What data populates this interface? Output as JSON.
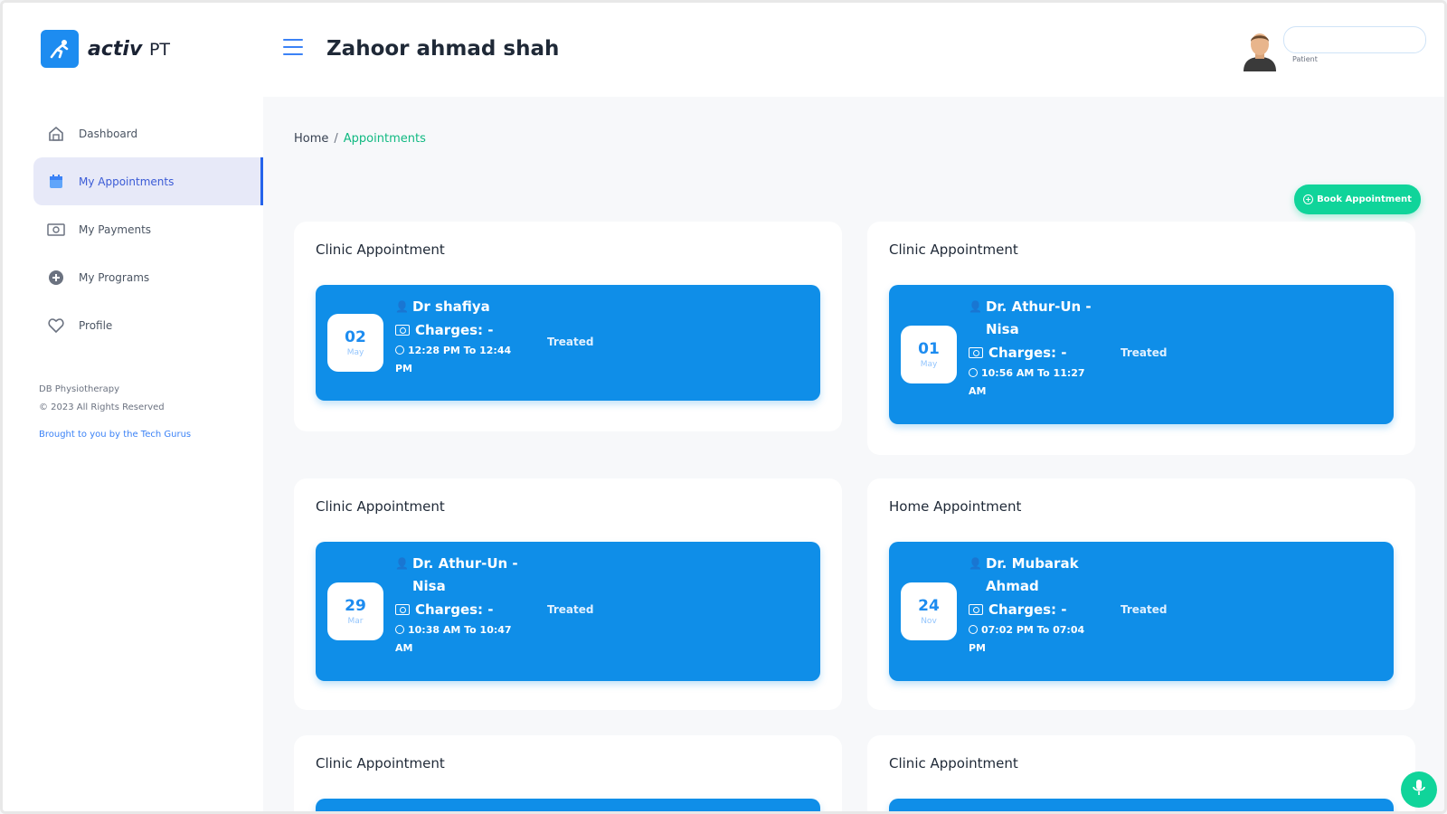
{
  "app": {
    "logo_text": "activ",
    "logo_suffix": "PT"
  },
  "sidebar": {
    "items": [
      {
        "label": "Dashboard",
        "icon": "home-icon",
        "active": false
      },
      {
        "label": "My Appointments",
        "icon": "calendar-icon",
        "active": true
      },
      {
        "label": "My Payments",
        "icon": "money-icon",
        "active": false
      },
      {
        "label": "My Programs",
        "icon": "plus-circle-icon",
        "active": false
      },
      {
        "label": "Profile",
        "icon": "heart-icon",
        "active": false
      }
    ],
    "footer_line1": "DB Physiotherapy",
    "footer_line2": "© 2023 All Rights Reserved",
    "footer_link": "Brought to you by the Tech Gurus"
  },
  "header": {
    "username": "Zahoor ahmad shah",
    "role": "Patient",
    "role_box_value": ""
  },
  "breadcrumb": {
    "home": "Home",
    "separator": "/",
    "current": "Appointments"
  },
  "book_button": "Book Appointment",
  "appointments": [
    {
      "title": "Clinic Appointment",
      "day": "02",
      "month": "May",
      "doctor": "Dr shafiya",
      "charges": "Charges: -",
      "time": "12:28 PM To 12:44 PM",
      "status": "Treated"
    },
    {
      "title": "Clinic Appointment",
      "day": "01",
      "month": "May",
      "doctor": "Dr. Athur-Un -Nisa",
      "charges": "Charges: -",
      "time": "10:56 AM To 11:27 AM",
      "status": "Treated"
    },
    {
      "title": "Clinic Appointment",
      "day": "29",
      "month": "Mar",
      "doctor": "Dr. Athur-Un -Nisa",
      "charges": "Charges: -",
      "time": "10:38 AM To 10:47 AM",
      "status": "Treated"
    },
    {
      "title": "Home Appointment",
      "day": "24",
      "month": "Nov",
      "doctor": "Dr. Mubarak Ahmad",
      "charges": "Charges: -",
      "time": "07:02 PM To 07:04 PM",
      "status": "Treated"
    },
    {
      "title": "Clinic Appointment"
    },
    {
      "title": "Clinic Appointment"
    }
  ],
  "colors": {
    "primary": "#0f8ee8",
    "accent": "#10d49a",
    "active_nav_bg": "#e7e9f8"
  }
}
